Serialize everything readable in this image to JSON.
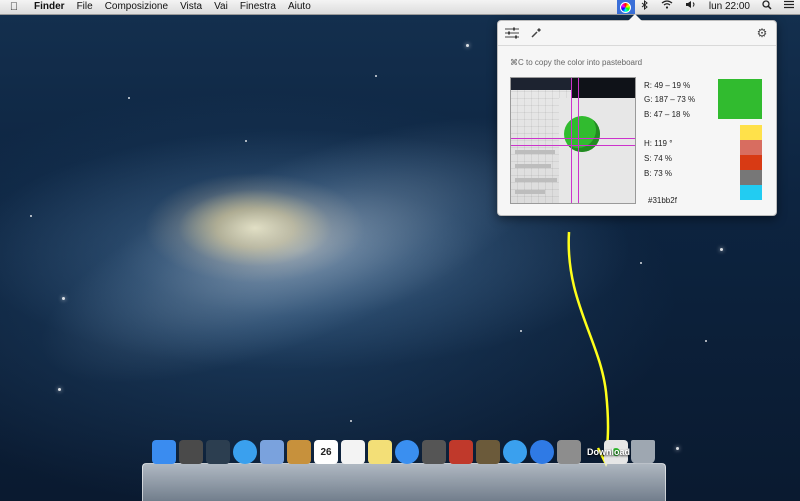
{
  "menubar": {
    "apple_icon": "apple-icon",
    "items": [
      "Finder",
      "File",
      "Composizione",
      "Vista",
      "Vai",
      "Finestra",
      "Aiuto"
    ],
    "clock": "lun 22:00",
    "status_icons": [
      "color-picker-icon",
      "bluetooth-icon",
      "wifi-icon",
      "volume-icon",
      "search-icon",
      "list-icon"
    ]
  },
  "picker": {
    "hint": "⌘C to copy the color into pasteboard",
    "r": "R: 49 – 19 %",
    "g": "G: 187 – 73 %",
    "b": "B: 47 – 18 %",
    "h": "H: 119 °",
    "s": "S: 74 %",
    "bv": "B: 73 %",
    "hex": "#31bb2f",
    "current_color": "#31bb2f",
    "palette": [
      "#ffe14a",
      "#d86d60",
      "#d83a14",
      "#777777",
      "#22ccf2"
    ]
  },
  "dock": {
    "label": "Download",
    "apps": [
      {
        "name": "finder-icon",
        "color": "#3a8cf0"
      },
      {
        "name": "launchpad-icon",
        "color": "#4a4a4a"
      },
      {
        "name": "mission-control-icon",
        "color": "#2c3e50"
      },
      {
        "name": "safari-icon",
        "color": "#3aa0ee"
      },
      {
        "name": "mail-icon",
        "color": "#7aa2dd"
      },
      {
        "name": "contacts-icon",
        "color": "#c7913c"
      },
      {
        "name": "calendar-icon",
        "color": "#ffffff"
      },
      {
        "name": "reminders-icon",
        "color": "#f3f3f3"
      },
      {
        "name": "notes-icon",
        "color": "#f3df77"
      },
      {
        "name": "messages-icon",
        "color": "#3a8ff0"
      },
      {
        "name": "facetime-icon",
        "color": "#555555"
      },
      {
        "name": "photo-booth-icon",
        "color": "#c0392b"
      },
      {
        "name": "iphoto-icon",
        "color": "#6b5a3a"
      },
      {
        "name": "itunes-icon",
        "color": "#3aa0ee"
      },
      {
        "name": "app-store-icon",
        "color": "#2f7ae5"
      },
      {
        "name": "system-preferences-icon",
        "color": "#8d8d8d"
      },
      {
        "name": "downloads-stack-icon",
        "color": "#e6e6e6"
      },
      {
        "name": "trash-icon",
        "color": "#b8c0c8"
      }
    ],
    "calendar_day": "26"
  },
  "annotation": {
    "color": "#ffff1a"
  }
}
